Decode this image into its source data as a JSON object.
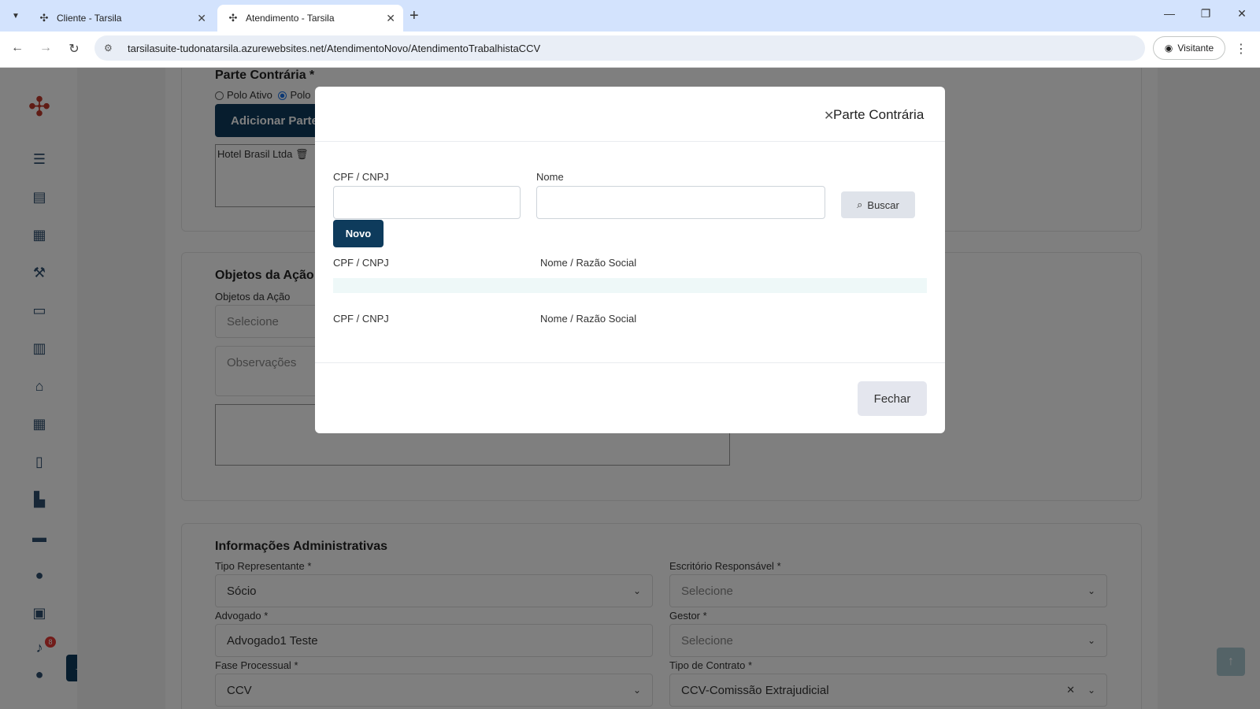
{
  "browser": {
    "tabs": [
      {
        "title": "Cliente - Tarsila",
        "active": false
      },
      {
        "title": "Atendimento - Tarsila",
        "active": true
      }
    ],
    "url": "tarsilasuite-tudonatarsila.azurewebsites.net/AtendimentoNovo/AtendimentoTrabalhistaCCV",
    "profile_label": "Visitante"
  },
  "sidebar": {
    "icons": [
      "list-icon",
      "id-card-icon",
      "calendar-icon",
      "gavel-icon",
      "money-icon",
      "book-icon",
      "bank-icon",
      "calendar-alt-icon",
      "file-icon",
      "chart-icon",
      "ticket-icon",
      "alert-icon",
      "robot-icon",
      "bell-icon",
      "user-icon"
    ],
    "notification_count": "8"
  },
  "page": {
    "parte_contraria": {
      "title": "Parte Contrária",
      "required_mark": "*",
      "radio_polo_ativo": "Polo Ativo",
      "radio_polo_passivo": "Polo",
      "add_button": "Adicionar Parte",
      "party_item": "Hotel Brasil Ltda"
    },
    "objetos": {
      "title": "Objetos da Ação",
      "label": "Objetos da Ação",
      "select_placeholder": "Selecione",
      "observacoes_placeholder": "Observações"
    },
    "admin": {
      "title": "Informações Administrativas",
      "tipo_representante_label": "Tipo Representante",
      "tipo_representante_value": "Sócio",
      "escritorio_label": "Escritório Responsável",
      "escritorio_value": "Selecione",
      "advogado_label": "Advogado",
      "advogado_value": "Advogado1 Teste",
      "gestor_label": "Gestor",
      "gestor_value": "Selecione",
      "fase_label": "Fase Processual",
      "fase_value": "CCV",
      "tipo_contrato_label": "Tipo de Contrato",
      "tipo_contrato_value": "CCV-Comissão Extrajudicial",
      "required_mark": "*"
    }
  },
  "modal": {
    "title": "Parte Contrária",
    "cpf_label": "CPF / CNPJ",
    "nome_label": "Nome",
    "buscar_label": "Buscar",
    "novo_label": "Novo",
    "table_header_cpf": "CPF / CNPJ",
    "table_header_nome": "Nome / Razão Social",
    "table_footer_cpf": "CPF / CNPJ",
    "table_footer_nome": "Nome / Razão Social",
    "fechar_label": "Fechar"
  }
}
